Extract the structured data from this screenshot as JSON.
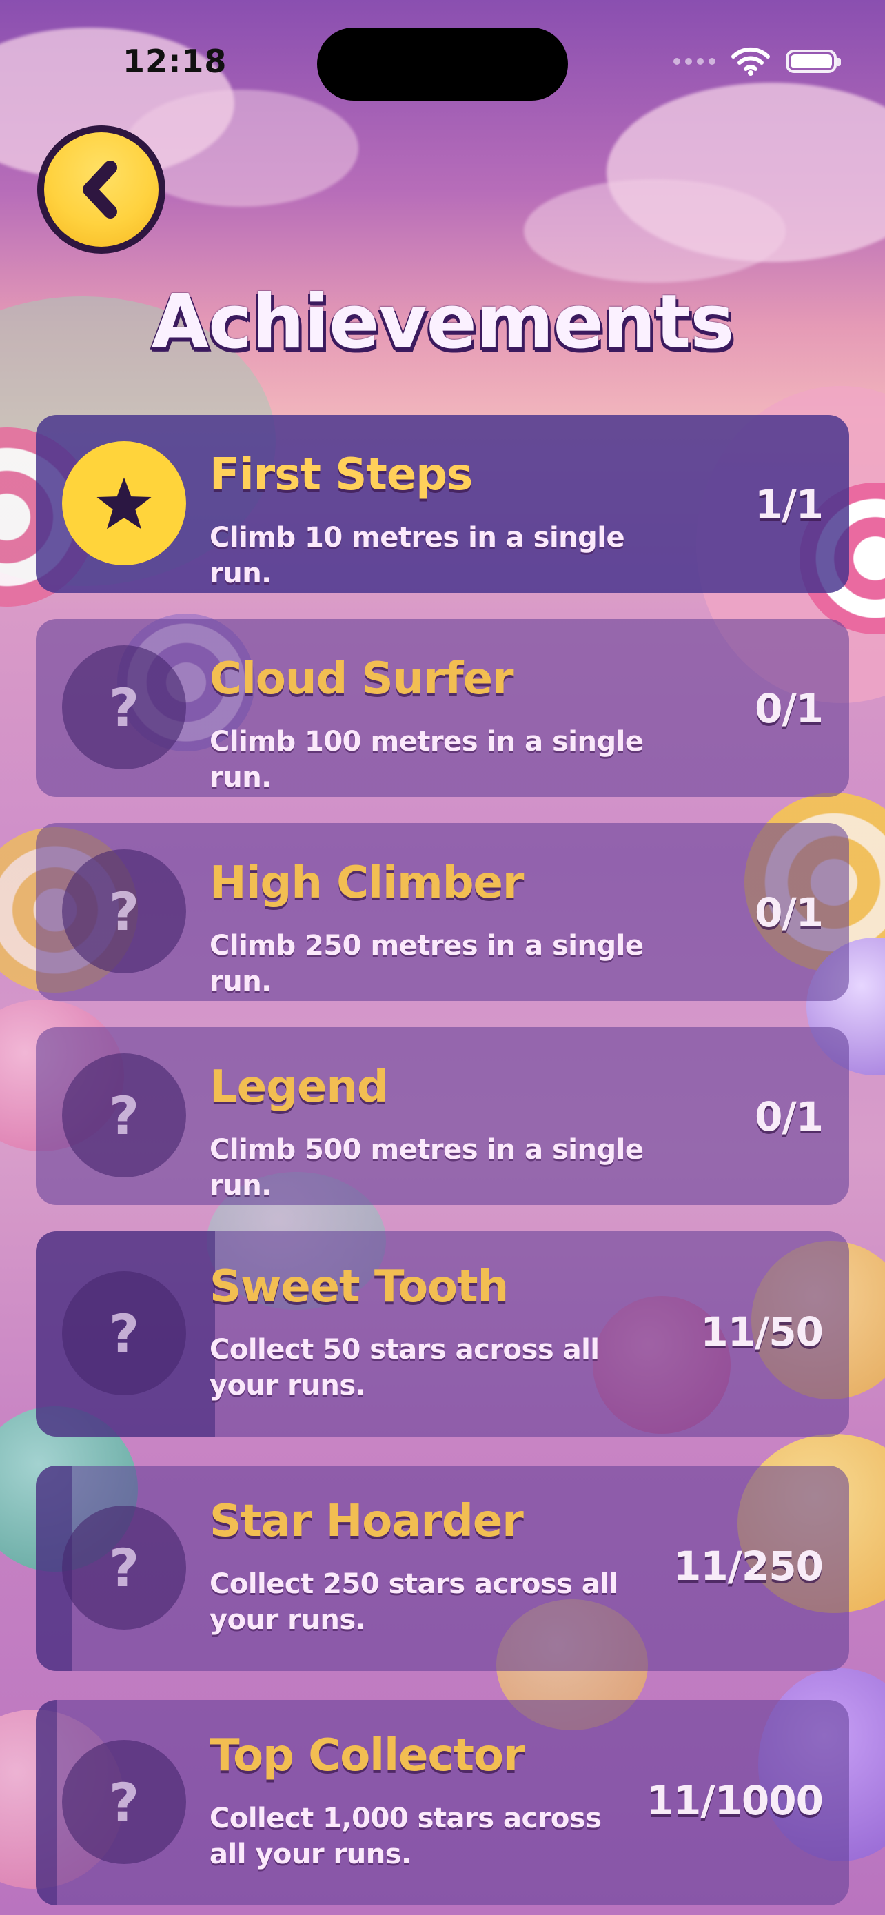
{
  "status_bar": {
    "time": "12:18"
  },
  "header": {
    "title": "Achievements"
  },
  "achievements": [
    {
      "name": "First Steps",
      "description": "Climb 10 metres in a single run.",
      "progress_text": "1/1",
      "progress": 1.0,
      "unlocked": true
    },
    {
      "name": "Cloud Surfer",
      "description": "Climb 100 metres in a single run.",
      "progress_text": "0/1",
      "progress": 0.0,
      "unlocked": false
    },
    {
      "name": "High Climber",
      "description": "Climb 250 metres in a single run.",
      "progress_text": "0/1",
      "progress": 0.0,
      "unlocked": false
    },
    {
      "name": "Legend",
      "description": "Climb 500 metres in a single run.",
      "progress_text": "0/1",
      "progress": 0.0,
      "unlocked": false
    },
    {
      "name": "Sweet Tooth",
      "description": "Collect 50 stars across all your runs.",
      "progress_text": "11/50",
      "progress": 0.22,
      "unlocked": false
    },
    {
      "name": "Star Hoarder",
      "description": "Collect 250 stars across all your runs.",
      "progress_text": "11/250",
      "progress": 0.044,
      "unlocked": false
    },
    {
      "name": "Top Collector",
      "description": "Collect 1,000 stars across all your runs.",
      "progress_text": "11/1000",
      "progress": 0.011,
      "unlocked": false
    }
  ],
  "icons": {
    "locked": "?",
    "unlocked": "star-icon",
    "back": "chevron-left-icon"
  },
  "colors": {
    "accent_yellow": "#ffd43b",
    "title_text": "#fbf1ff",
    "name_text": "#f2be52",
    "dark_purple": "#2e1640"
  }
}
